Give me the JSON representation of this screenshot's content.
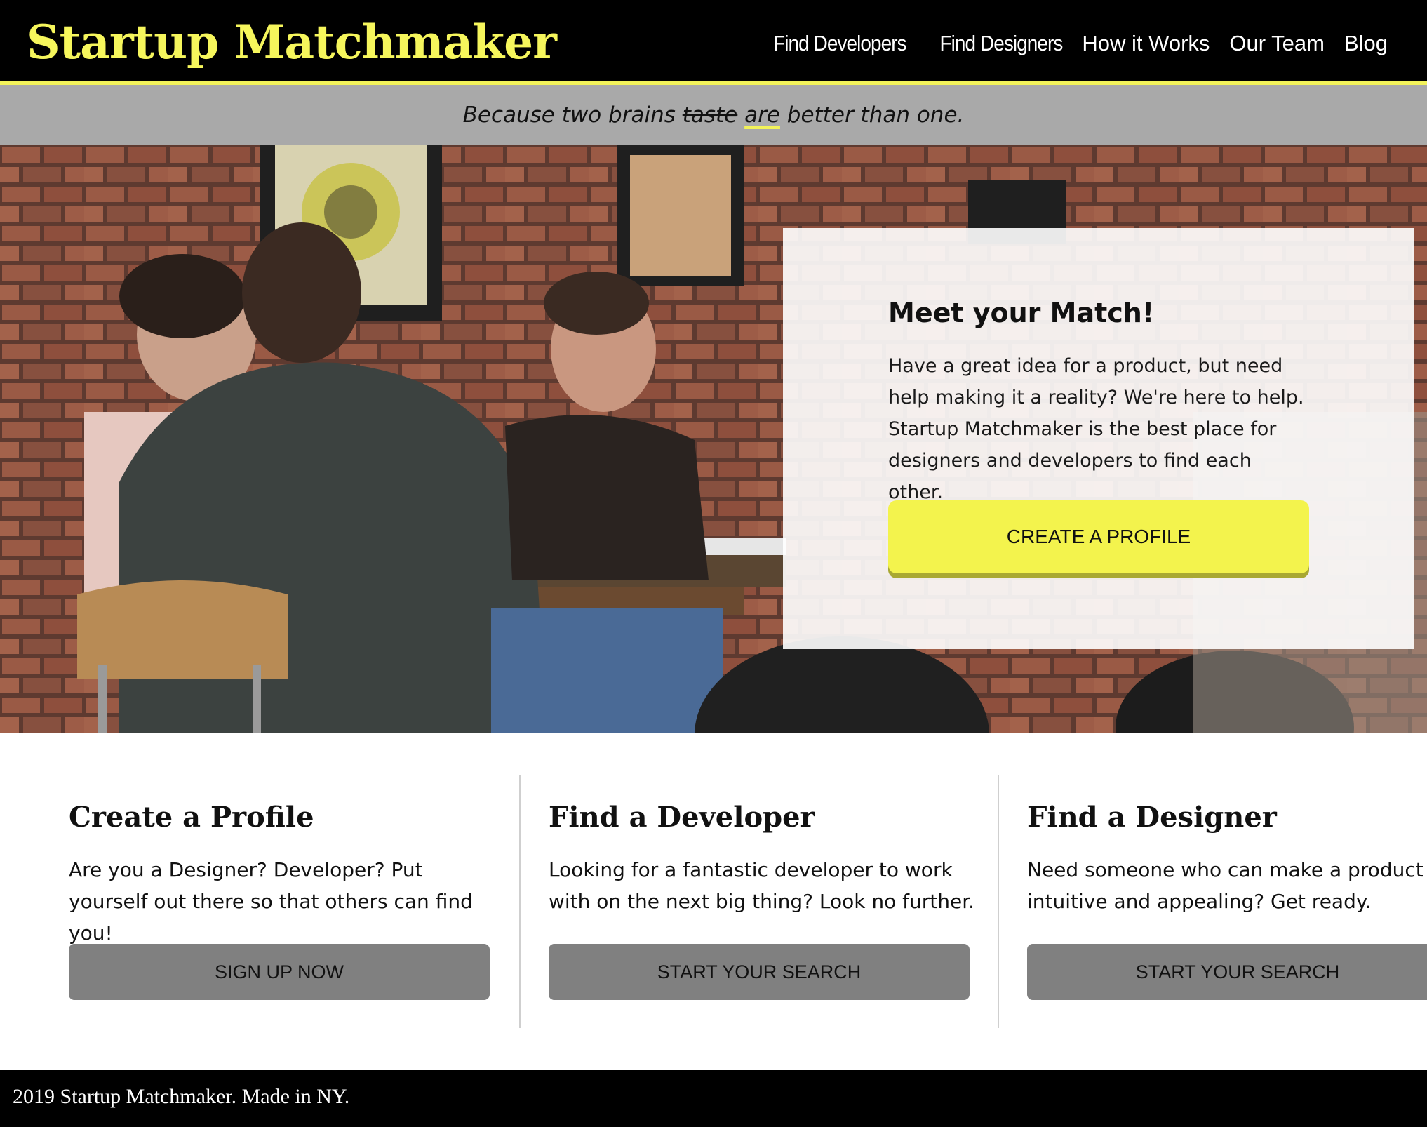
{
  "header": {
    "logo": "Startup Matchmaker",
    "nav": [
      "Find Developers",
      "Find Designers",
      "How it Works",
      "Our Team",
      "Blog"
    ]
  },
  "tagline": {
    "before": "Because two brains ",
    "struck": "taste",
    "highlight": "are",
    "after": " better than one."
  },
  "hero": {
    "title": "Meet your Match!",
    "body": "Have a great idea for a product, but need help making it a reality? We're here to help. Startup Matchmaker is the best place for designers and developers to find each other.",
    "cta": "CREATE A PROFILE"
  },
  "features": [
    {
      "title": "Create a Profile",
      "body": "Are you a Designer? Developer? Put yourself out there so that others can find you!",
      "button": "SIGN UP NOW"
    },
    {
      "title": "Find a Developer",
      "body": "Looking for a fantastic developer to work with on the next big thing? Look no further.",
      "button": "START YOUR SEARCH"
    },
    {
      "title": "Find a Designer",
      "body": "Need someone who can make a product intuitive and appealing? Get ready.",
      "button": "START YOUR SEARCH"
    }
  ],
  "footer": {
    "text": "2019 Startup Matchmaker. Made in NY."
  },
  "colors": {
    "accent": "#f2f25a",
    "header_bg": "#000000",
    "tagline_bg": "#a9a9a9",
    "button_gray": "#808080",
    "cta_yellow": "#f3f34d"
  }
}
